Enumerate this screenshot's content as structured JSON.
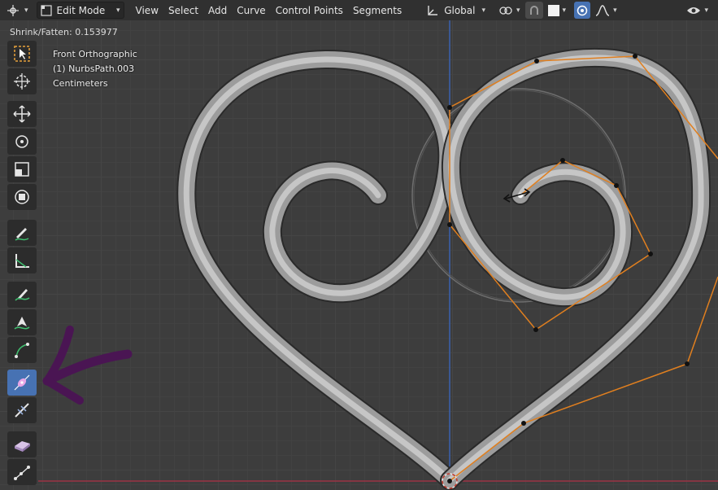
{
  "header": {
    "mode_label": "Edit Mode",
    "menus": [
      "View",
      "Select",
      "Add",
      "Curve",
      "Control Points",
      "Segments"
    ],
    "orientation_label": "Global"
  },
  "operator": {
    "readout": "Shrink/Fatten: 0.153977"
  },
  "viewport": {
    "view_name": "Front Orthographic",
    "object_label": "(1) NurbsPath.003",
    "units": "Centimeters"
  },
  "toolbar": {
    "tools": [
      {
        "name": "select-box-icon"
      },
      {
        "name": "cursor-icon"
      },
      {
        "name": "move-icon"
      },
      {
        "name": "rotate-icon"
      },
      {
        "name": "scale-icon"
      },
      {
        "name": "transform-icon"
      },
      {
        "name": "annotate-icon"
      },
      {
        "name": "measure-icon"
      },
      {
        "name": "draw-icon"
      },
      {
        "name": "pen-icon"
      },
      {
        "name": "extrude-icon"
      },
      {
        "name": "radius-icon",
        "active": true
      },
      {
        "name": "tilt-icon"
      },
      {
        "name": "randomize-icon"
      },
      {
        "name": "vertex-icon"
      }
    ]
  },
  "colors": {
    "accent": "#4772b3",
    "handle": "#e07f1f",
    "annotation_arrow": "#4a1553",
    "x_axis": "#9c3344",
    "y_axis": "#3a62b0"
  }
}
